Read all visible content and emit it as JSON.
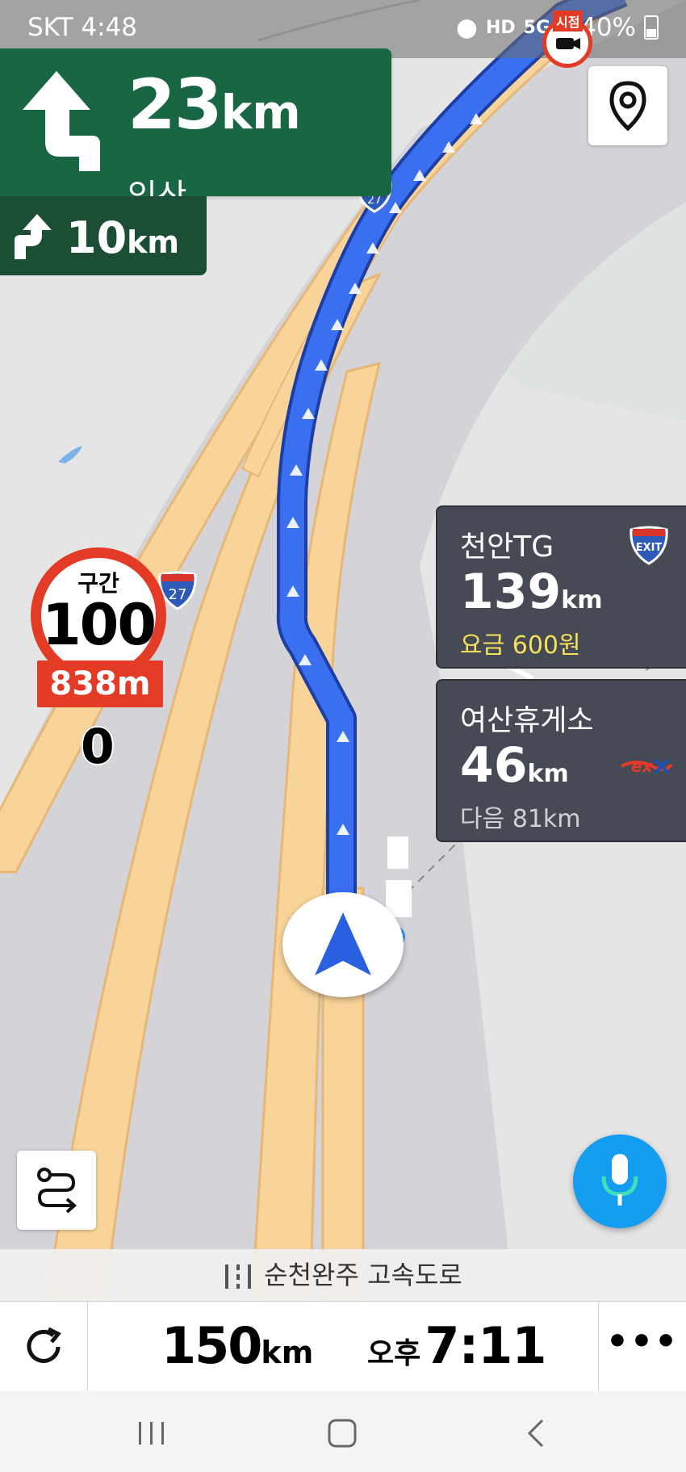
{
  "status_bar": {
    "carrier_time": "SKT 4:48",
    "hd_voice": "HD",
    "network": "5G",
    "battery": "40%"
  },
  "guidance": {
    "main_distance": "23",
    "main_unit": "km",
    "main_place": "익산",
    "next_distance": "10",
    "next_unit": "km",
    "camera_label": "시점"
  },
  "speed_limit": {
    "section_label": "구간",
    "limit": "100",
    "remaining": "838m",
    "current_speed": "0"
  },
  "map_labels": {
    "shield_top": "27",
    "shield_left": "27"
  },
  "cards": [
    {
      "name": "천안TG",
      "distance": "139",
      "unit": "km",
      "sub": "요금 600원",
      "icon": "exit-icon",
      "icon_text": "EXIT"
    },
    {
      "name": "여산휴게소",
      "distance": "46",
      "unit": "km",
      "sub": "다음 81km",
      "icon": "ex-logo-icon"
    }
  ],
  "road_name": "순천완주 고속도로",
  "summary": {
    "remaining_distance": "150",
    "remaining_unit": "km",
    "eta_period": "오후",
    "eta_time": "7:11",
    "more": "•••"
  },
  "colors": {
    "guidance_green": "#186644",
    "route_blue": "#3a6ff0",
    "speed_red": "#e33b26",
    "card_bg": "#464a55",
    "mic_blue": "#149cf0"
  }
}
